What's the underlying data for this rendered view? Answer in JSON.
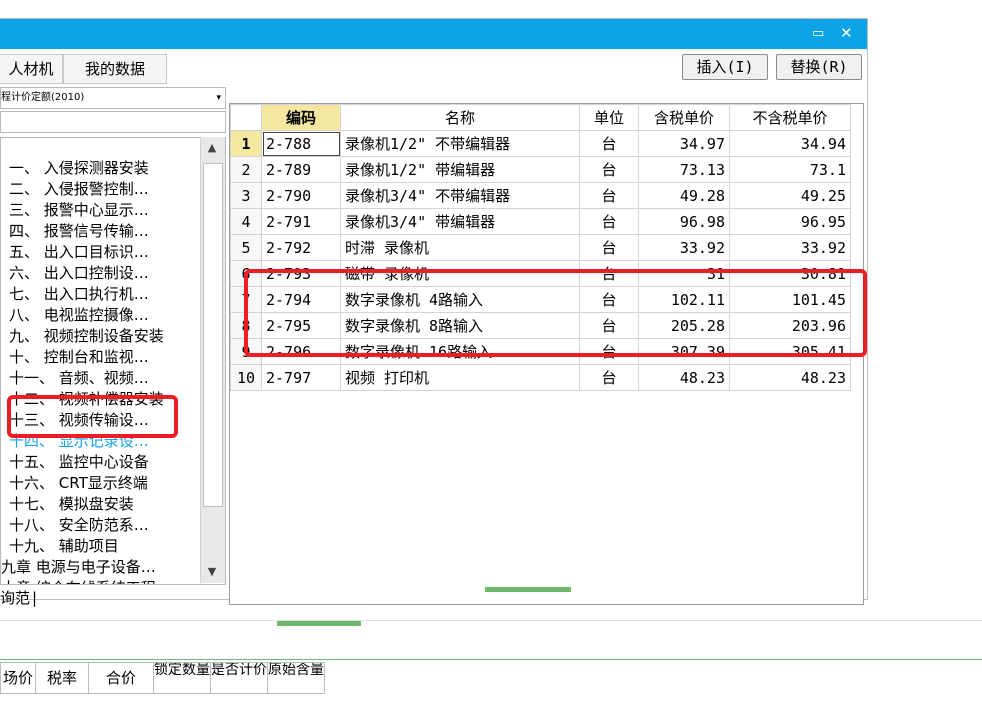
{
  "tabs": [
    "人材机",
    "我的数据"
  ],
  "buttons": {
    "insert": "插入(I)",
    "replace": "替换(R)"
  },
  "quota_selector": {
    "value": "程计价定额(2010)"
  },
  "tree": {
    "items": [
      "一、  入侵探测器安装",
      "二、  入侵报警控制…",
      "三、  报警中心显示…",
      "四、  报警信号传输…",
      "五、  出入口目标识…",
      "六、  出入口控制设…",
      "七、  出入口执行机…",
      "八、  电视监控摄像…",
      "九、  视频控制设备安装",
      "十、  控制台和监视…",
      "十一、  音频、视频…",
      "十二、  视频补偿器安装",
      "十三、  视频传输设…",
      "十四、  显示记录设…",
      "十五、  监控中心设备",
      "十六、  CRT显示终端",
      "十七、  模拟盘安装",
      "十八、  安全防范系…",
      "十九、  辅助项目",
      "九章 电源与电子设备…",
      "十章 综合布线系统工程"
    ],
    "selected_index": 13
  },
  "bottom_label": "询范",
  "table": {
    "columns": [
      "编码",
      "名称",
      "单位",
      "含税单价",
      "不含税单价"
    ],
    "rows": [
      {
        "n": "1",
        "code": "2-788",
        "name": "录像机1/2\"  不带编辑器",
        "unit": "台",
        "tax": "34.97",
        "notax": "34.94"
      },
      {
        "n": "2",
        "code": "2-789",
        "name": "录像机1/2\"  带编辑器",
        "unit": "台",
        "tax": "73.13",
        "notax": "73.1"
      },
      {
        "n": "3",
        "code": "2-790",
        "name": "录像机3/4\"  不带编辑器",
        "unit": "台",
        "tax": "49.28",
        "notax": "49.25"
      },
      {
        "n": "4",
        "code": "2-791",
        "name": "录像机3/4\"  带编辑器",
        "unit": "台",
        "tax": "96.98",
        "notax": "96.95"
      },
      {
        "n": "5",
        "code": "2-792",
        "name": "时滞 录像机",
        "unit": "台",
        "tax": "33.92",
        "notax": "33.92"
      },
      {
        "n": "6",
        "code": "2-793",
        "name": "磁带 录像机",
        "unit": "台",
        "tax": "31",
        "notax": "30.81"
      },
      {
        "n": "7",
        "code": "2-794",
        "name": "数字录像机 4路输入",
        "unit": "台",
        "tax": "102.11",
        "notax": "101.45"
      },
      {
        "n": "8",
        "code": "2-795",
        "name": "数字录像机 8路输入",
        "unit": "台",
        "tax": "205.28",
        "notax": "203.96"
      },
      {
        "n": "9",
        "code": "2-796",
        "name": "数字录像机 16路输入",
        "unit": "台",
        "tax": "307.39",
        "notax": "305.41"
      },
      {
        "n": "10",
        "code": "2-797",
        "name": "视频 打印机",
        "unit": "台",
        "tax": "48.23",
        "notax": "48.23"
      }
    ]
  },
  "bottom_headers": [
    "场价",
    "税率",
    "合价",
    "锁定数量",
    "是否计价",
    "原始含量"
  ],
  "colors": {
    "titlebar": "#0ca4e6",
    "highlight": "#ee1c25",
    "selected_text": "#1aa3e8",
    "code_header": "#f5e7a2"
  }
}
